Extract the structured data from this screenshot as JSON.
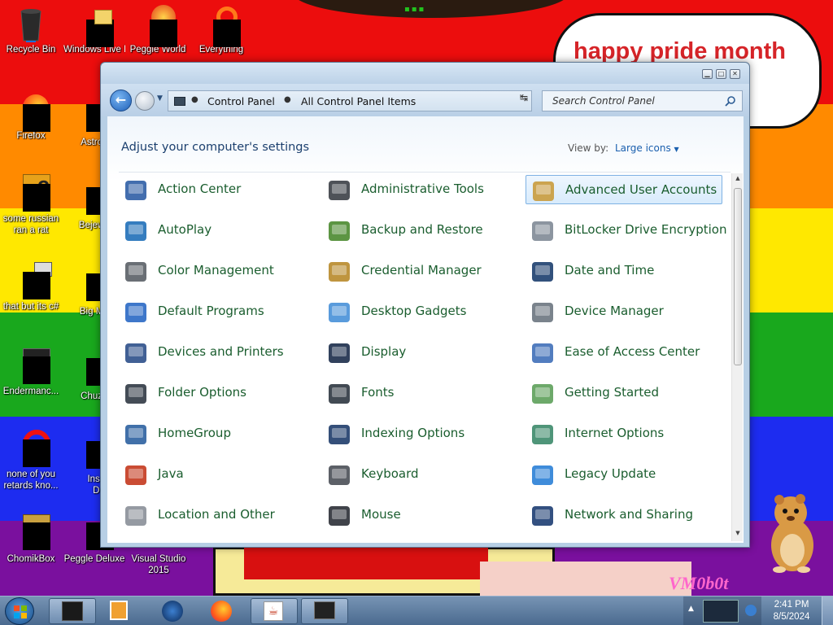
{
  "wallpaper": {
    "bubble_text": "happy pride month",
    "vm_label": "VM0b0t",
    "stripe_colors": [
      "#ec0d0d",
      "#ff8a00",
      "#ffe800",
      "#19a81d",
      "#1d2cf0",
      "#7a109e"
    ]
  },
  "desktop_icons": [
    {
      "label": "Recycle Bin",
      "icon": "recycle-bin-icon"
    },
    {
      "label": "Windows Live Mail",
      "icon": "windows-live-mail-icon"
    },
    {
      "label": "Peggle World",
      "icon": "peggle-world-icon"
    },
    {
      "label": "Everything",
      "icon": "everything-icon"
    },
    {
      "label": "Firefox",
      "icon": "firefox-icon"
    },
    {
      "label": "Astro Delu",
      "icon": "astro-deluxe-icon"
    },
    {
      "label": "some russian ran a rat",
      "icon": "video-file-icon"
    },
    {
      "label": "Bejew Delu",
      "icon": "bejeweled-deluxe-icon"
    },
    {
      "label": "that but its c#",
      "icon": "shortcut-icon"
    },
    {
      "label": "Big M Delu",
      "icon": "big-money-deluxe-icon"
    },
    {
      "label": "Endermanc...",
      "icon": "endermanch-icon"
    },
    {
      "label": "Chuz Delu",
      "icon": "chuzzle-deluxe-icon"
    },
    {
      "label": "none of you retards kno...",
      "icon": "opera-icon"
    },
    {
      "label": "Insaniq Delu",
      "icon": "insaniquarium-deluxe-icon"
    },
    {
      "label": "ChomikBox",
      "icon": "chomikbox-icon"
    },
    {
      "label": "Peggle Deluxe",
      "icon": "peggle-deluxe-icon"
    },
    {
      "label": "Visual Studio 2015",
      "icon": "visual-studio-icon"
    }
  ],
  "window": {
    "breadcrumbs": [
      "Control Panel",
      "All Control Panel Items"
    ],
    "search_placeholder": "Search Control Panel",
    "heading": "Adjust your computer's settings",
    "view_by_label": "View by:",
    "view_by_value": "Large icons",
    "items": [
      {
        "label": "Action Center",
        "icon": "action-center-icon"
      },
      {
        "label": "Administrative Tools",
        "icon": "administrative-tools-icon"
      },
      {
        "label": "Advanced User Accounts",
        "icon": "advanced-user-accounts-icon"
      },
      {
        "label": "AutoPlay",
        "icon": "autoplay-icon"
      },
      {
        "label": "Backup and Restore",
        "icon": "backup-restore-icon"
      },
      {
        "label": "BitLocker Drive Encryption",
        "icon": "bitlocker-icon"
      },
      {
        "label": "Color Management",
        "icon": "color-management-icon"
      },
      {
        "label": "Credential Manager",
        "icon": "credential-manager-icon"
      },
      {
        "label": "Date and Time",
        "icon": "date-time-icon"
      },
      {
        "label": "Default Programs",
        "icon": "default-programs-icon"
      },
      {
        "label": "Desktop Gadgets",
        "icon": "desktop-gadgets-icon"
      },
      {
        "label": "Device Manager",
        "icon": "device-manager-icon"
      },
      {
        "label": "Devices and Printers",
        "icon": "devices-printers-icon"
      },
      {
        "label": "Display",
        "icon": "display-icon"
      },
      {
        "label": "Ease of Access Center",
        "icon": "ease-of-access-icon"
      },
      {
        "label": "Folder Options",
        "icon": "folder-options-icon"
      },
      {
        "label": "Fonts",
        "icon": "fonts-icon"
      },
      {
        "label": "Getting Started",
        "icon": "getting-started-icon"
      },
      {
        "label": "HomeGroup",
        "icon": "homegroup-icon"
      },
      {
        "label": "Indexing Options",
        "icon": "indexing-options-icon"
      },
      {
        "label": "Internet Options",
        "icon": "internet-options-icon"
      },
      {
        "label": "Java",
        "icon": "java-icon"
      },
      {
        "label": "Keyboard",
        "icon": "keyboard-icon"
      },
      {
        "label": "Legacy Update",
        "icon": "legacy-update-icon"
      },
      {
        "label": "Location and Other",
        "icon": "location-sensors-icon"
      },
      {
        "label": "Mouse",
        "icon": "mouse-icon"
      },
      {
        "label": "Network and Sharing",
        "icon": "network-sharing-icon"
      }
    ]
  },
  "taskbar": {
    "items": [
      {
        "icon": "media-center-icon",
        "state": "open"
      },
      {
        "icon": "media-player-icon",
        "state": "pinned"
      },
      {
        "icon": "globe-icon",
        "state": "pinned"
      },
      {
        "icon": "firefox-icon",
        "state": "pinned"
      },
      {
        "icon": "java-icon",
        "state": "open"
      },
      {
        "icon": "control-panel-icon",
        "state": "open"
      }
    ],
    "time": "2:41 PM",
    "date": "8/5/2024"
  }
}
